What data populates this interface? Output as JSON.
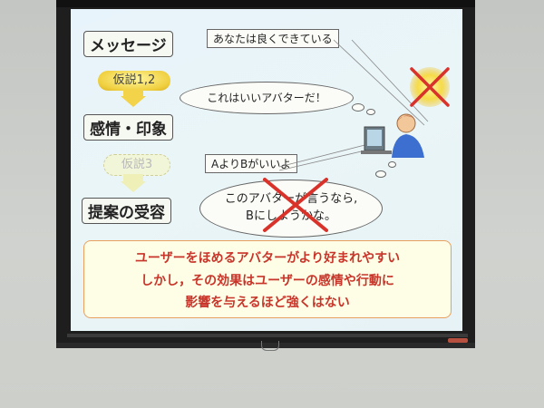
{
  "slide": {
    "steps": {
      "message": "メッセージ",
      "emotion": "感情・印象",
      "acceptance": "提案の受容"
    },
    "hypotheses": {
      "h12": "仮説1,2",
      "h3": "仮説3"
    },
    "bubbles": {
      "good_job": "あなたは良くできている",
      "good_avatar": "これはいいアバターだ！",
      "a_vs_b": "AよりBがいいよ",
      "think_line1": "このアバターが言うなら,",
      "think_line2": "Bにしようかな。"
    },
    "conclusion": {
      "line1": "ユーザーをほめるアバターがより好まれやすい",
      "line2": "しかし，その効果はユーザーの感情や行動に",
      "line3": "影響を与えるほど強くはない"
    }
  },
  "colors": {
    "slide_bg": "#e8f4fb",
    "arrow_yellow": "#f2d34a",
    "cross_red": "#d9322a",
    "conclusion_text": "#c8352a",
    "conclusion_border": "#e8a060"
  },
  "icons": [
    "cross-mark-icon",
    "sun-icon",
    "person-at-computer-icon"
  ]
}
